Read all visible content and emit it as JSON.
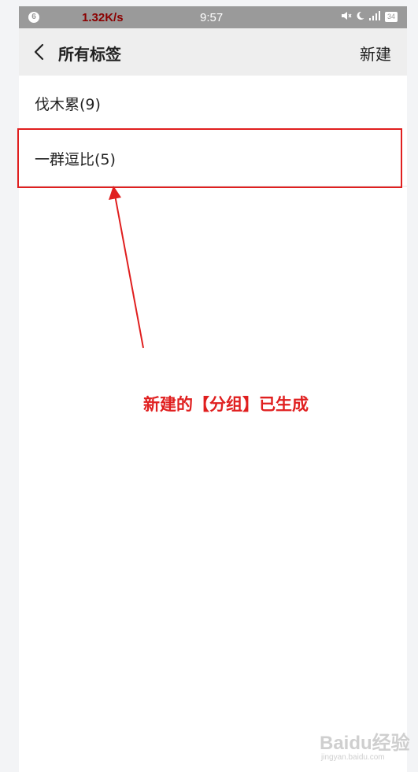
{
  "status_bar": {
    "notification_count": "6",
    "speed": "1.32K/s",
    "time": "9:57",
    "battery": "34",
    "icons": [
      "mute-icon",
      "moon-icon",
      "signal-icon",
      "battery-icon"
    ]
  },
  "header": {
    "title": "所有标签",
    "new_label": "新建"
  },
  "list": {
    "items": [
      {
        "label": "伐木累(9)"
      },
      {
        "label": "一群逗比(5)"
      }
    ]
  },
  "annotation": {
    "text": "新建的【分组】已生成",
    "color": "#e01f1f"
  },
  "watermark": {
    "text": "Baidu经验",
    "sub": "jingyan.baidu.com"
  }
}
